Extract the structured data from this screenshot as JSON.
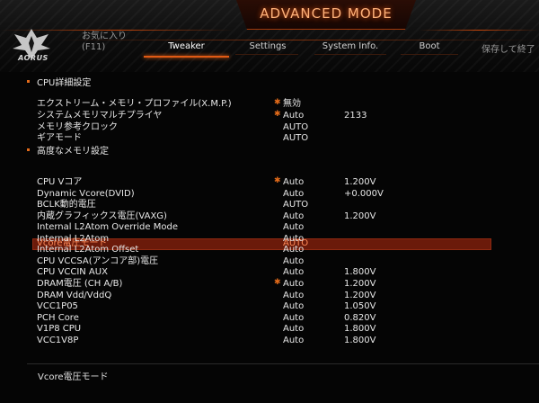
{
  "header": {
    "mode_title": "ADVANCED MODE",
    "logo_text": "AORUS",
    "favorites": {
      "line1": "お気に入り",
      "line2": "(F11)"
    },
    "tabs": [
      {
        "label": "Tweaker",
        "active": true
      },
      {
        "label": "Settings",
        "active": false
      },
      {
        "label": "System Info.",
        "active": false
      },
      {
        "label": "Boot",
        "active": false
      }
    ],
    "save_exit": "保存して終了"
  },
  "menu": {
    "section_cpu": "CPU詳細設定",
    "rows_top": [
      {
        "label": "エクストリーム・メモリ・プロファイル(X.M.P.)",
        "value": "無効",
        "value2": "",
        "star": true
      },
      {
        "label": "システムメモリマルチプライヤ",
        "value": "Auto",
        "value2": "2133",
        "star": true
      },
      {
        "label": "メモリ参考クロック",
        "value": "AUTO",
        "value2": "",
        "star": false
      },
      {
        "label": "ギアモード",
        "value": "AUTO",
        "value2": "",
        "star": false
      }
    ],
    "section_mem": "高度なメモリ設定",
    "highlight_row": {
      "label": "Vcore電圧モード",
      "value": "AUTO"
    },
    "rows_volt": [
      {
        "label": "CPU Vコア",
        "value": "Auto",
        "value2": "1.200V",
        "star": true
      },
      {
        "label": "Dynamic Vcore(DVID)",
        "value": "Auto",
        "value2": "+0.000V",
        "star": false
      },
      {
        "label": "BCLK動的電圧",
        "value": "AUTO",
        "value2": "",
        "star": false
      },
      {
        "label": "内蔵グラフィックス電圧(VAXG)",
        "value": "Auto",
        "value2": "1.200V",
        "star": false
      },
      {
        "label": "Internal L2Atom Override Mode",
        "value": "Auto",
        "value2": "",
        "star": false
      },
      {
        "label": "Internal L2Atom",
        "value": "Auto",
        "value2": "",
        "star": false
      },
      {
        "label": "Internal L2Atom Offset",
        "value": "Auto",
        "value2": "",
        "star": false
      },
      {
        "label": "CPU VCCSA(アンコア部)電圧",
        "value": "Auto",
        "value2": "",
        "star": false
      },
      {
        "label": "CPU VCCIN AUX",
        "value": "Auto",
        "value2": "1.800V",
        "star": false
      },
      {
        "label": "DRAM電圧 (CH A/B)",
        "value": "Auto",
        "value2": "1.200V",
        "star": true
      },
      {
        "label": "DRAM Vdd/VddQ",
        "value": "Auto",
        "value2": "1.200V",
        "star": false
      },
      {
        "label": "VCC1P05",
        "value": "Auto",
        "value2": "1.050V",
        "star": false
      },
      {
        "label": "PCH Core",
        "value": "Auto",
        "value2": "0.820V",
        "star": false
      },
      {
        "label": "V1P8 CPU",
        "value": "Auto",
        "value2": "1.800V",
        "star": false
      },
      {
        "label": "VCC1V8P",
        "value": "Auto",
        "value2": "1.800V",
        "star": false
      }
    ]
  },
  "help_text": "Vcore電圧モード",
  "colors": {
    "accent": "#e36b1a",
    "highlight": "#6b1a0a",
    "highlight_text": "#ff8c5a"
  }
}
